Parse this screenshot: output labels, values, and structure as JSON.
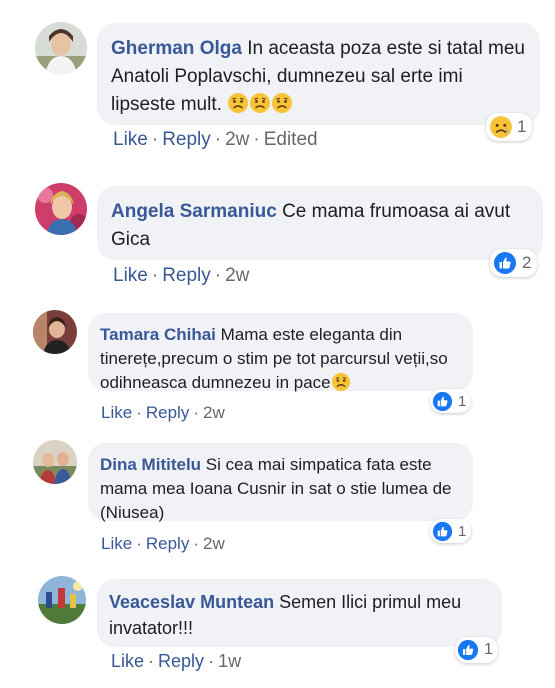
{
  "colors": {
    "bubble_bg": "#f0f2f5",
    "name": "#385898",
    "link": "#385898",
    "meta": "#65676b",
    "like_blue": "#1877f2"
  },
  "comments": [
    {
      "author": "Gherman Olga",
      "text": "In aceasta poza este si tatal meu Anatoli Poplavschi, dumnezeu sal erte imi lipseste mult.",
      "text_emoji": "sad-face-emoji x3",
      "actions": {
        "like": "Like",
        "reply": "Reply",
        "time": "2w",
        "edited": "Edited"
      },
      "reaction": {
        "icon": "sad-reaction-icon",
        "count": "1"
      }
    },
    {
      "author": "Angela Sarmaniuc",
      "text": "Ce mama frumoasa ai avut Gica",
      "actions": {
        "like": "Like",
        "reply": "Reply",
        "time": "2w"
      },
      "reaction": {
        "icon": "like-reaction-icon",
        "count": "2"
      }
    },
    {
      "author": "Tamara Chihai",
      "text": "Mama este eleganta din tinerețe,precum o stim pe tot parcursul veții,so odihneasca dumnezeu in pace",
      "text_emoji": "sad-face-emoji",
      "actions": {
        "like": "Like",
        "reply": "Reply",
        "time": "2w"
      },
      "reaction": {
        "icon": "like-reaction-icon",
        "count": "1"
      }
    },
    {
      "author": "Dina Mititelu",
      "text": "Si cea mai simpatica fata este mama mea Ioana Cusnir in sat o stie lumea de (Niusea)",
      "actions": {
        "like": "Like",
        "reply": "Reply",
        "time": "2w"
      },
      "reaction": {
        "icon": "like-reaction-icon",
        "count": "1"
      }
    },
    {
      "author": "Veaceslav Muntean",
      "text": "Semen Ilici primul meu invatator!!!",
      "actions": {
        "like": "Like",
        "reply": "Reply",
        "time": "1w"
      },
      "reaction": {
        "icon": "like-reaction-icon",
        "count": "1"
      }
    }
  ]
}
